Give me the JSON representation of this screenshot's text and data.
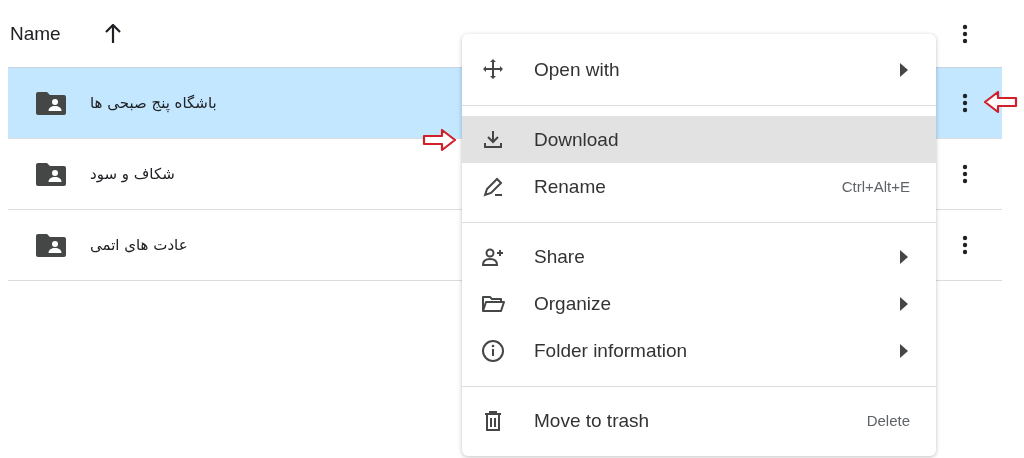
{
  "header": {
    "column_1": "Name",
    "sorted_ascending": true
  },
  "rows": [
    {
      "name": "باشگاه پنج صبحی ها",
      "selected": true
    },
    {
      "name": "شکاف و سود",
      "selected": false
    },
    {
      "name": "عادت های اتمی",
      "selected": false
    }
  ],
  "context_menu": {
    "sections": [
      [
        {
          "label": "Open with",
          "submenu": true,
          "selected": false
        }
      ],
      [
        {
          "label": "Download",
          "submenu": false,
          "selected": true
        },
        {
          "label": "Rename",
          "shortcut": "Ctrl+Alt+E",
          "submenu": false,
          "selected": false
        }
      ],
      [
        {
          "label": "Share",
          "submenu": true,
          "selected": false
        },
        {
          "label": "Organize",
          "submenu": true,
          "selected": false
        },
        {
          "label": "Folder information",
          "submenu": true,
          "selected": false
        }
      ],
      [
        {
          "label": "Move to trash",
          "shortcut": "Delete",
          "submenu": false,
          "selected": false
        }
      ]
    ]
  }
}
